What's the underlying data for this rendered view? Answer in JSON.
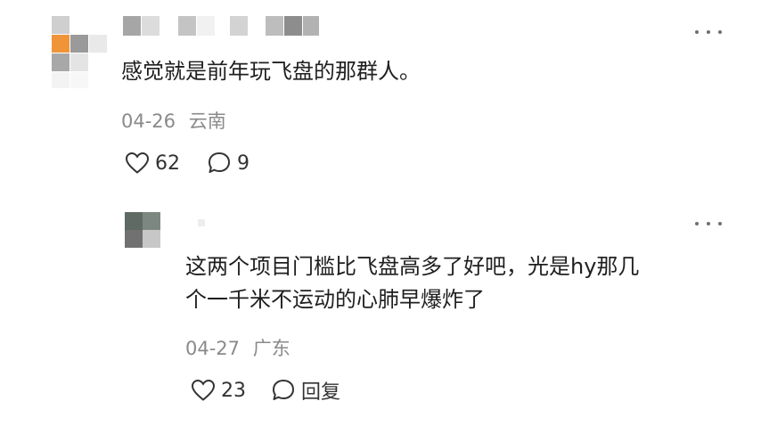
{
  "comments": [
    {
      "text": "感觉就是前年玩飞盘的那群人。",
      "date": "04-26",
      "location": "云南",
      "like_count": "62",
      "reply_count": "9",
      "like_icon": "heart-icon",
      "reply_icon": "speech-bubble-icon",
      "more_icon": "more-dots-icon"
    }
  ],
  "reply": {
    "text_line1": "这两个项目门槛比飞盘高多了好吧，光是hy那几",
    "text_line2": "个一千米不运动的心肺早爆炸了",
    "date": "04-27",
    "location": "广东",
    "like_count": "23",
    "reply_label": "回复",
    "like_icon": "heart-icon",
    "reply_icon": "speech-bubble-icon",
    "more_icon": "more-dots-icon"
  },
  "colors": {
    "text": "#1f1f1f",
    "meta": "#8a8a8a",
    "avatar_accent": "#f0943a"
  }
}
